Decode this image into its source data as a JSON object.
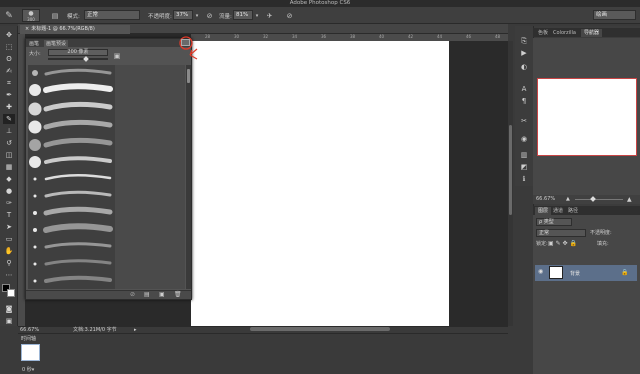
{
  "app": {
    "title": "Adobe Photoshop CS6"
  },
  "options_bar": {
    "brush_size": "300",
    "mode_label": "模式:",
    "mode_value": "正常",
    "opacity_label": "不透明度:",
    "opacity_value": "37%",
    "flow_label": "流量:",
    "flow_value": "81%",
    "workspace": "绘画"
  },
  "document": {
    "tab_title": "未标题-1 @ 66.7%(RGB/8)",
    "zoom": "66.67%",
    "doc_info": "文档:3.21M/0 字节",
    "ruler_marks": [
      "28",
      "30",
      "32",
      "34",
      "36",
      "38",
      "40",
      "42",
      "44",
      "46",
      "48"
    ]
  },
  "brush_panel": {
    "tab1": "画笔",
    "tab2": "画笔预设",
    "size_label": "大小:",
    "size_value": "200 像素"
  },
  "timeline": {
    "label": "时间轴",
    "frame_time": "0 秒▾"
  },
  "navigator": {
    "tabs": [
      "色板",
      "Colorzilla",
      "导航器"
    ],
    "zoom": "66.67%"
  },
  "layers": {
    "tabs": [
      "图层",
      "通道",
      "路径"
    ],
    "kind_label": "ρ 类型",
    "blend_mode": "正常",
    "opacity_label": "不透明度:",
    "lock_label": "锁定:",
    "fill_label": "填充:",
    "layer_name": "背景"
  },
  "colors": {
    "accent_annotation": "#e03b2a",
    "selected_layer": "#5c6f8a"
  }
}
